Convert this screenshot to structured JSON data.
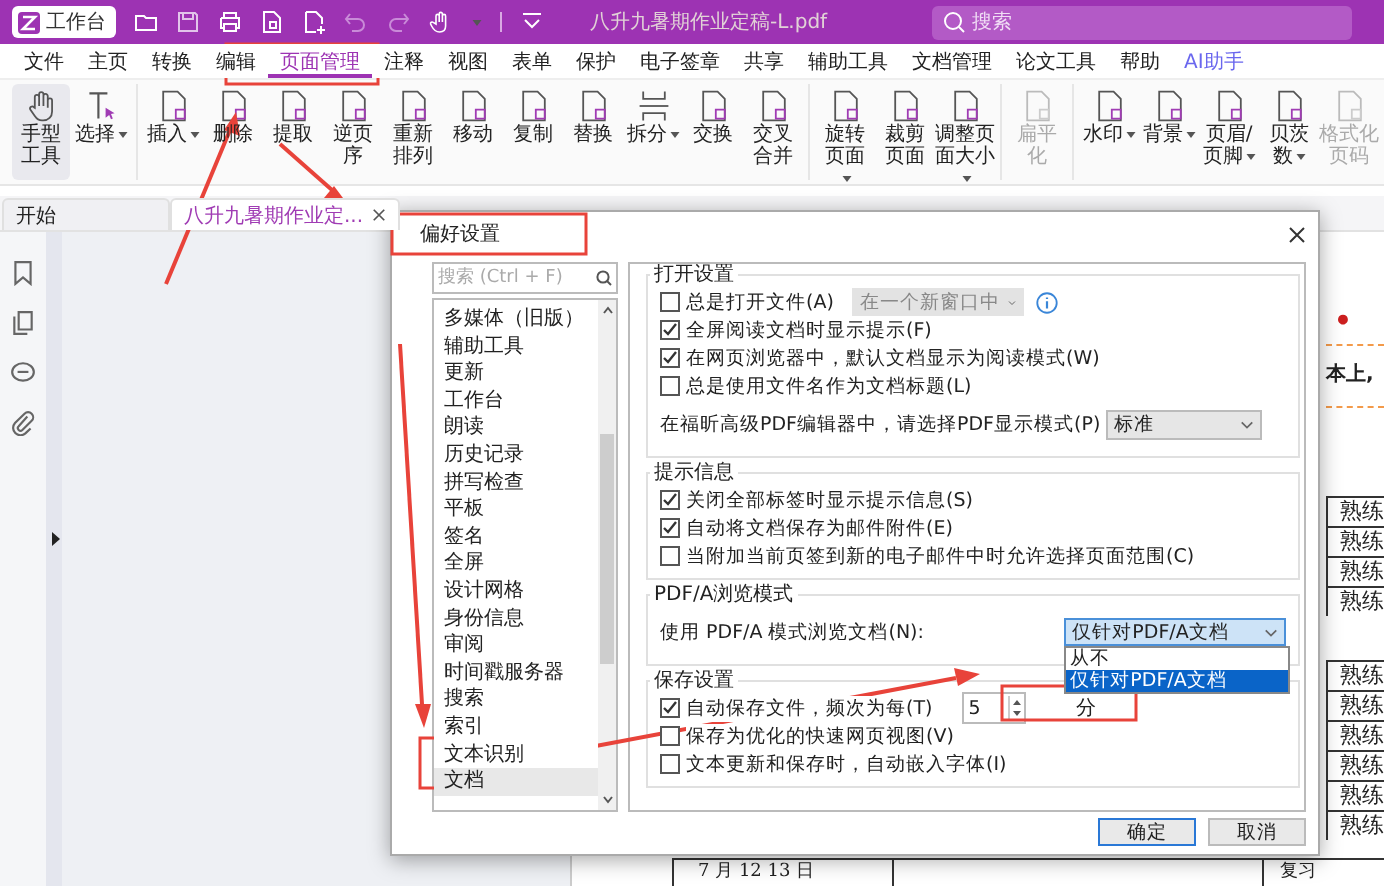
{
  "window": {
    "workbench_button": "工作台",
    "title": "八升九暑期作业定稿-L.pdf",
    "search": {
      "placeholder": "搜索"
    }
  },
  "menu_tabs": [
    {
      "label": "文件",
      "kind": "tab",
      "selected": false
    },
    {
      "label": "主页",
      "kind": "tab",
      "selected": false
    },
    {
      "label": "转换",
      "kind": "tab",
      "selected": false
    },
    {
      "label": "编辑",
      "kind": "tab",
      "selected": false
    },
    {
      "label": "页面管理",
      "kind": "tab",
      "selected": true
    },
    {
      "label": "注释",
      "kind": "tab",
      "selected": false
    },
    {
      "label": "视图",
      "kind": "tab",
      "selected": false
    },
    {
      "label": "表单",
      "kind": "tab",
      "selected": false
    },
    {
      "label": "保护",
      "kind": "tab",
      "selected": false
    },
    {
      "label": "电子签章",
      "kind": "tab",
      "selected": false
    },
    {
      "label": "共享",
      "kind": "tab",
      "selected": false
    },
    {
      "label": "辅助工具",
      "kind": "tab",
      "selected": false
    },
    {
      "label": "文档管理",
      "kind": "tab",
      "selected": false
    },
    {
      "label": "论文工具",
      "kind": "tab",
      "selected": false
    },
    {
      "label": "帮助",
      "kind": "tab",
      "selected": false
    },
    {
      "label": "AI助手",
      "kind": "ai",
      "selected": false
    }
  ],
  "ribbon": [
    [
      {
        "label": "手型工具",
        "kind": "hand",
        "dropdown": false,
        "disabled": false,
        "selected": true
      },
      {
        "label": "选择",
        "kind": "select",
        "dropdown": true,
        "disabled": false,
        "selected": false
      }
    ],
    [
      {
        "label": "插入",
        "kind": "page",
        "dropdown": true,
        "disabled": false,
        "selected": false
      },
      {
        "label": "删除",
        "kind": "page",
        "dropdown": false,
        "disabled": false,
        "selected": false
      },
      {
        "label": "提取",
        "kind": "page",
        "dropdown": false,
        "disabled": false,
        "selected": false
      },
      {
        "label": "逆页序",
        "kind": "page",
        "dropdown": false,
        "disabled": false,
        "selected": false
      },
      {
        "label": "重新排列",
        "kind": "page",
        "dropdown": false,
        "disabled": false,
        "selected": false
      },
      {
        "label": "移动",
        "kind": "page",
        "dropdown": false,
        "disabled": false,
        "selected": false
      },
      {
        "label": "复制",
        "kind": "page",
        "dropdown": false,
        "disabled": false,
        "selected": false
      },
      {
        "label": "替换",
        "kind": "page",
        "dropdown": false,
        "disabled": false,
        "selected": false
      },
      {
        "label": "拆分",
        "kind": "split",
        "dropdown": true,
        "disabled": false,
        "selected": false
      },
      {
        "label": "交换",
        "kind": "page",
        "dropdown": false,
        "disabled": false,
        "selected": false
      },
      {
        "label": "交叉合并",
        "kind": "page",
        "dropdown": false,
        "disabled": false,
        "selected": false
      }
    ],
    [
      {
        "label": "旋转页面",
        "kind": "page",
        "dropdown": true,
        "disabled": false,
        "selected": false
      },
      {
        "label": "裁剪页面",
        "kind": "page",
        "dropdown": false,
        "disabled": false,
        "selected": false
      },
      {
        "label": "调整页面大小",
        "kind": "page",
        "dropdown": true,
        "disabled": false,
        "selected": false
      }
    ],
    [
      {
        "label": "扁平化",
        "kind": "page",
        "dropdown": false,
        "disabled": true,
        "selected": false
      }
    ],
    [
      {
        "label": "水印",
        "kind": "page",
        "dropdown": true,
        "disabled": false,
        "selected": false
      },
      {
        "label": "背景",
        "kind": "page",
        "dropdown": true,
        "disabled": false,
        "selected": false
      },
      {
        "label": "页眉/页脚",
        "kind": "page",
        "dropdown": true,
        "disabled": false,
        "selected": false
      },
      {
        "label": "贝茨数",
        "kind": "page",
        "dropdown": true,
        "disabled": false,
        "selected": false
      },
      {
        "label": "格式化页码",
        "kind": "page",
        "dropdown": false,
        "disabled": true,
        "selected": false
      }
    ]
  ],
  "doc_tabs": [
    {
      "label": "开始",
      "selected": false,
      "closable": false
    },
    {
      "label": "八升九暑期作业定...",
      "selected": true,
      "closable": true
    }
  ],
  "document": {
    "bullet": "•",
    "text_line": "本上,",
    "practice_rows": [
      [
        "熟练",
        "熟练",
        "熟练",
        "熟练"
      ],
      [
        "熟练",
        "熟练",
        "熟练",
        "熟练",
        "熟练",
        "熟练"
      ]
    ],
    "table_row": {
      "date": "7 月 12 13 日",
      "note": "复习"
    }
  },
  "dialog": {
    "title": "偏好设置",
    "search": {
      "placeholder": "搜索 (Ctrl + F)"
    },
    "categories": [
      {
        "label": "多媒体（旧版）",
        "selected": false
      },
      {
        "label": "辅助工具",
        "selected": false
      },
      {
        "label": "更新",
        "selected": false
      },
      {
        "label": "工作台",
        "selected": false
      },
      {
        "label": "朗读",
        "selected": false
      },
      {
        "label": "历史记录",
        "selected": false
      },
      {
        "label": "拼写检查",
        "selected": false
      },
      {
        "label": "平板",
        "selected": false
      },
      {
        "label": "签名",
        "selected": false
      },
      {
        "label": "全屏",
        "selected": false
      },
      {
        "label": "设计网格",
        "selected": false
      },
      {
        "label": "身份信息",
        "selected": false
      },
      {
        "label": "审阅",
        "selected": false
      },
      {
        "label": "时间戳服务器",
        "selected": false
      },
      {
        "label": "搜索",
        "selected": false
      },
      {
        "label": "索引",
        "selected": false
      },
      {
        "label": "文本识别",
        "selected": false
      },
      {
        "label": "文档",
        "selected": true
      }
    ],
    "sections": [
      {
        "title": "打开设置",
        "rows": [
          {
            "kind": "check",
            "label": "总是打开文件(A)",
            "checked": false,
            "combo": {
              "value": "在一个新窗口中",
              "disabled": true
            }
          },
          {
            "kind": "check",
            "label": "全屏阅读文档时显示提示(F)",
            "checked": true
          },
          {
            "kind": "check",
            "label": "在网页浏览器中，默认文档显示为阅读模式(W)",
            "checked": true
          },
          {
            "kind": "check",
            "label": "总是使用文件名作为文档标题(L)",
            "checked": false
          },
          {
            "kind": "select",
            "label": "在福昕高级PDF编辑器中，请选择PDF显示模式(P)",
            "value": "标准",
            "expanded": false
          }
        ]
      },
      {
        "title": "提示信息",
        "rows": [
          {
            "kind": "check",
            "label": "关闭全部标签时显示提示信息(S)",
            "checked": true
          },
          {
            "kind": "check",
            "label": "自动将文档保存为邮件附件(E)",
            "checked": true
          },
          {
            "kind": "check",
            "label": "当附加当前页签到新的电子邮件中时允许选择页面范围(C)",
            "checked": false
          }
        ]
      },
      {
        "title": "PDF/A浏览模式",
        "rows": [
          {
            "kind": "select",
            "label": "使用 PDF/A 模式浏览文档(N):",
            "value": "仅针对PDF/A文档",
            "expanded": true,
            "options": [
              {
                "label": "从不",
                "selected": false
              },
              {
                "label": "仅针对PDF/A文档",
                "selected": true
              }
            ]
          }
        ]
      },
      {
        "title": "保存设置",
        "rows": [
          {
            "kind": "spin",
            "label": "自动保存文件，频次为每(T)",
            "checked": true,
            "value": "5",
            "unit": "分"
          },
          {
            "kind": "check",
            "label": "保存为优化的快速网页视图(V)",
            "checked": false
          },
          {
            "kind": "check",
            "label": "文本更新和保存时，自动嵌入字体(I)",
            "checked": false
          }
        ]
      }
    ],
    "buttons": [
      {
        "label": "确定",
        "default": true
      },
      {
        "label": "取消",
        "default": false
      }
    ]
  }
}
